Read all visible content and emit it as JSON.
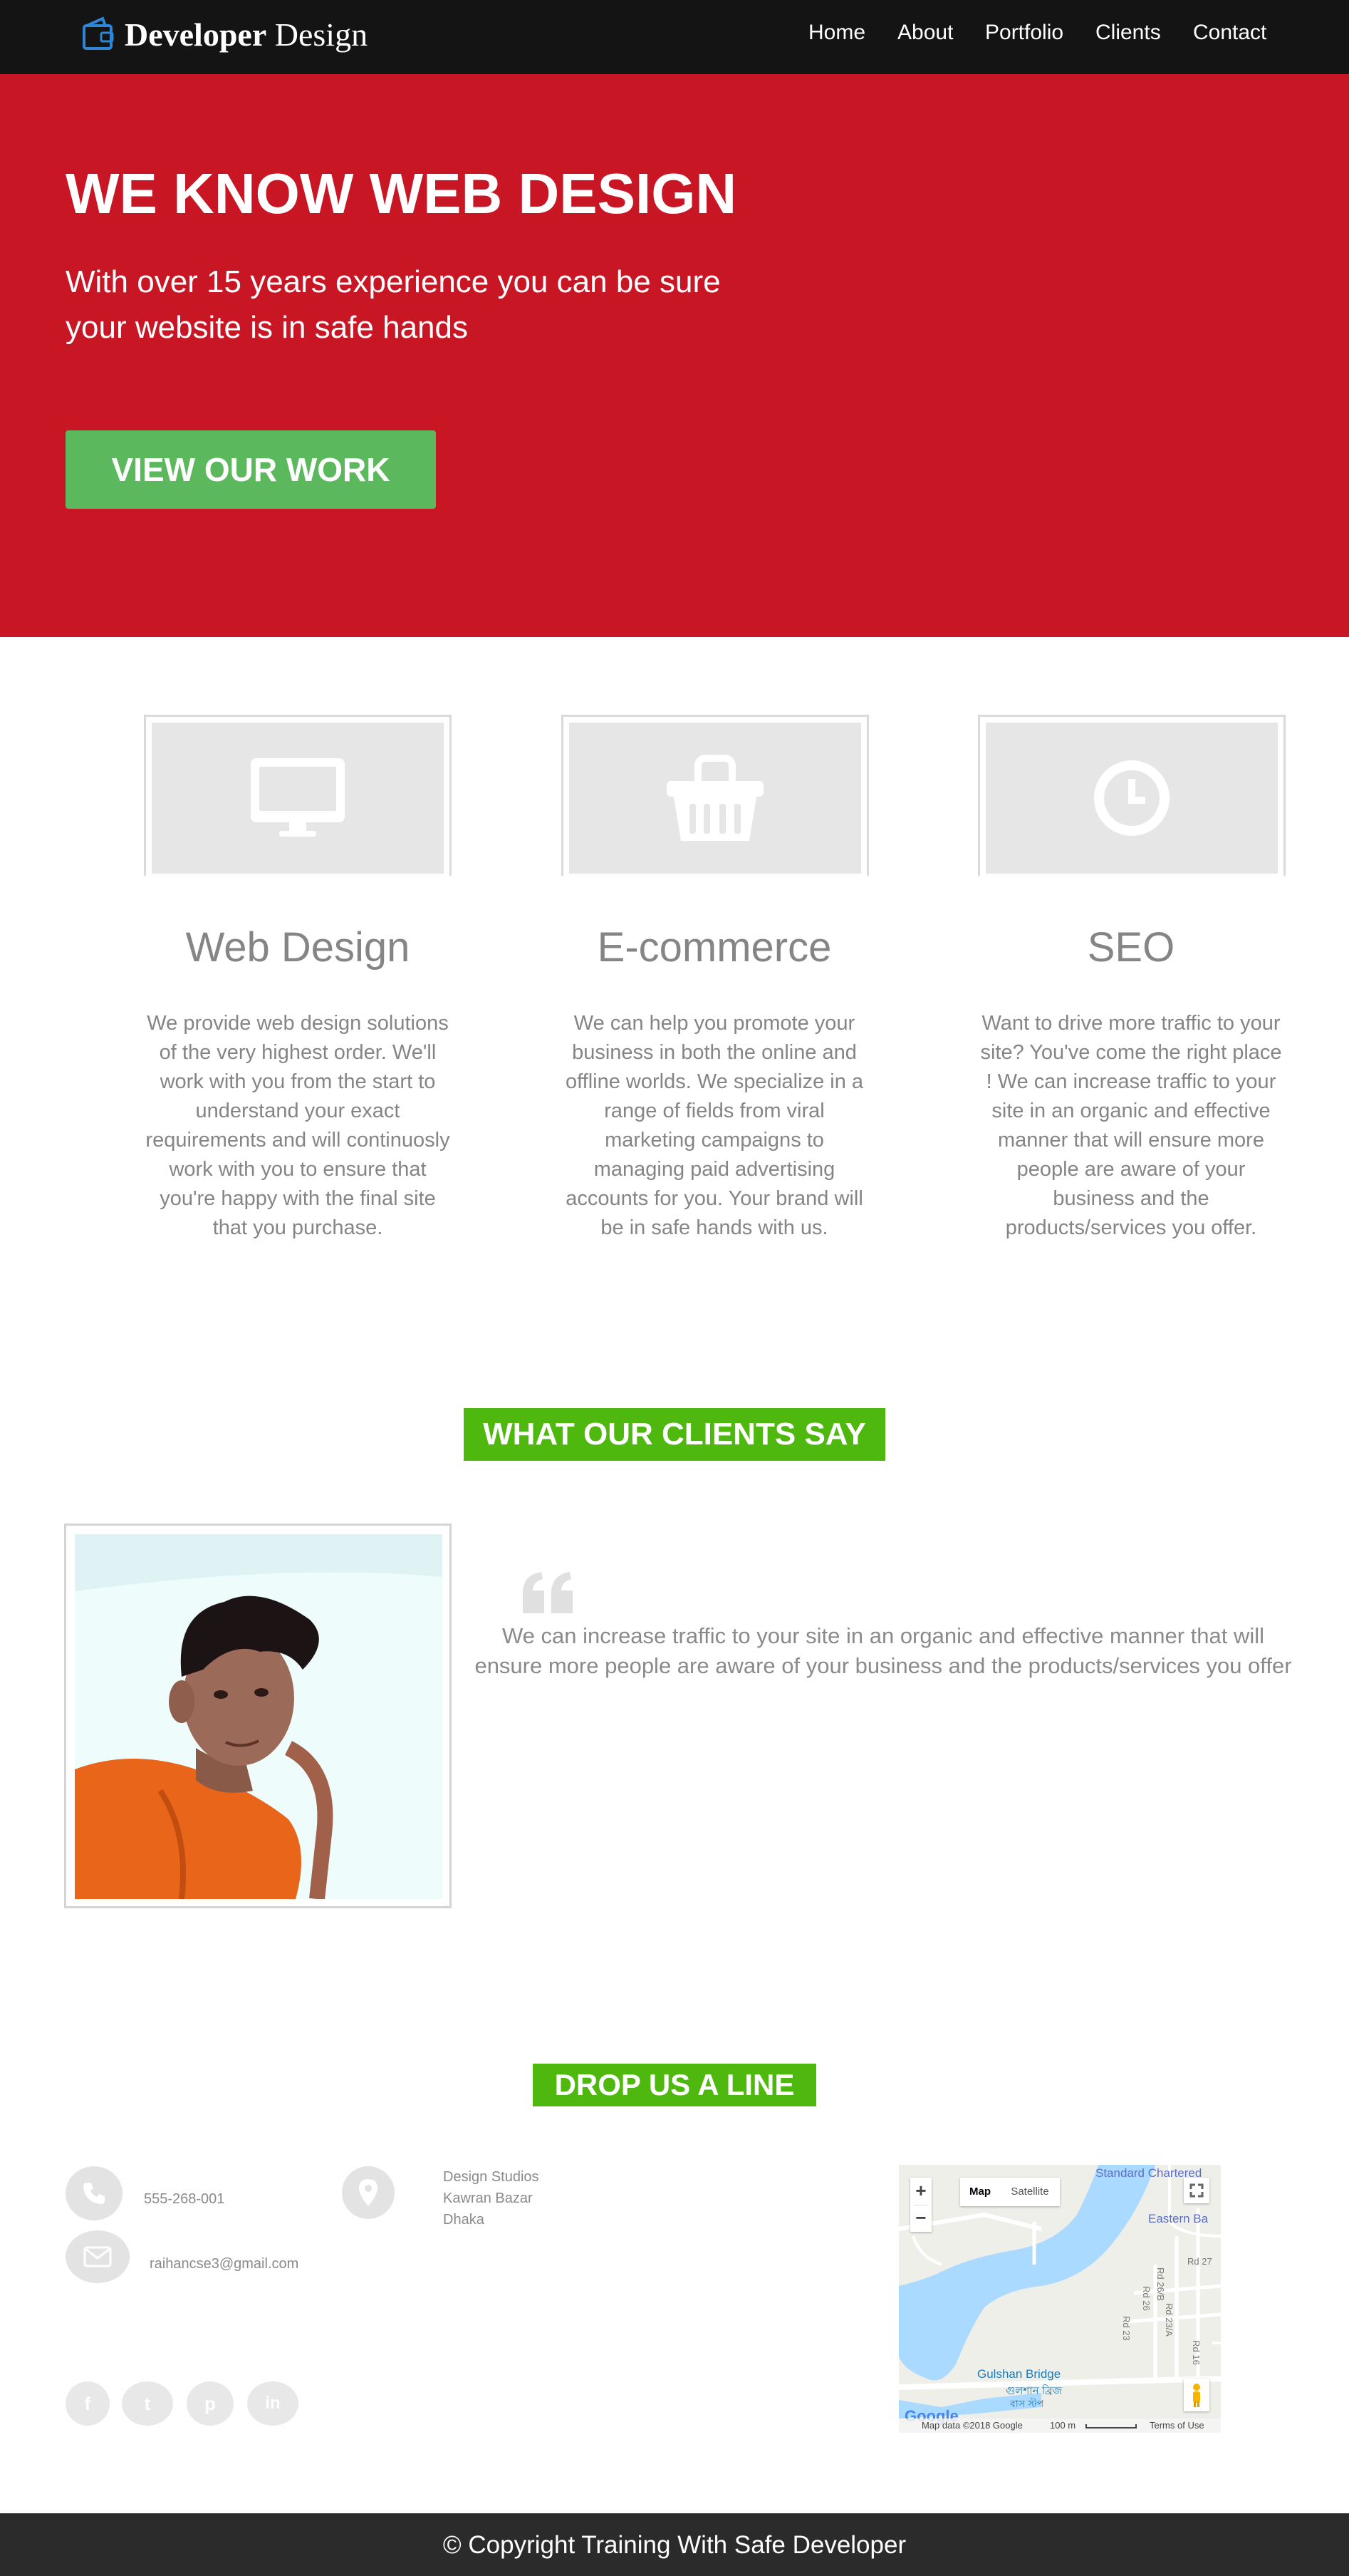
{
  "brand": {
    "bold": "Developer",
    "regular": "Design",
    "icon": "wallet-icon"
  },
  "nav": {
    "items": [
      {
        "label": "Home"
      },
      {
        "label": "About"
      },
      {
        "label": "Portfolio"
      },
      {
        "label": "Clients"
      },
      {
        "label": "Contact"
      }
    ]
  },
  "hero": {
    "title": "WE KNOW WEB DESIGN",
    "subtitle_lines": [
      "With over 15 years experience you can be sure",
      "your website is in safe hands"
    ],
    "button_label": "VIEW OUR WORK",
    "background": "#c81624",
    "button_color": "#5cb85c"
  },
  "services": [
    {
      "icon": "monitor-icon",
      "title": "Web Design",
      "lines": [
        "We provide web design solutions",
        "of the very highest order. We'll",
        "work with you from the start to",
        "understand your exact",
        "requirements and will continuosly",
        "work with you to ensure that",
        "you're happy with the final site",
        "that you purchase."
      ]
    },
    {
      "icon": "shopping-basket-icon",
      "title": "E-commerce",
      "lines": [
        "We can help you promote your",
        "business in both the online and",
        "offline worlds. We specialize in a",
        "range of fields from viral",
        "marketing campaigns to",
        "managing paid advertising",
        "accounts for you. Your brand will",
        "be in safe hands with us."
      ]
    },
    {
      "icon": "clock-icon",
      "title": "SEO",
      "lines": [
        "Want to drive more traffic to your",
        "site? You've come the right place",
        "! We can increase traffic to your",
        "site in an organic and effective",
        "manner that will ensure more",
        "people are aware of your",
        "business and the",
        "products/services you offer."
      ]
    }
  ],
  "testimonials": {
    "heading": "WHAT OUR CLIENTS SAY",
    "quote_icon": "quote-left-icon",
    "quote_lines": [
      "We can increase traffic to your site in an organic and effective manner that will",
      "ensure more people are aware of your business and the products/services you offer"
    ]
  },
  "contact": {
    "heading": "DROP US A LINE",
    "phone": "555-268-001",
    "email": "raihancse3@gmail.com",
    "address_lines": [
      "Design Studios",
      "Kawran Bazar",
      "Dhaka"
    ],
    "icons": [
      "phone-icon",
      "map-marker-icon",
      "envelope-icon"
    ],
    "social": [
      {
        "icon": "facebook-icon",
        "glyph": "f"
      },
      {
        "icon": "twitter-icon",
        "glyph": "t"
      },
      {
        "icon": "pinterest-icon",
        "glyph": "p"
      },
      {
        "icon": "linkedin-icon",
        "glyph": "in"
      }
    ]
  },
  "map": {
    "type_map": "Map",
    "type_satellite": "Satellite",
    "zoom_in": "+",
    "zoom_out": "−",
    "labels": {
      "standard_chartered": "Standard Chartered",
      "eastern_bank": "Eastern Ba",
      "gulshan_bridge": "Gulshan Bridge",
      "gulshan_bridge_bn": "গুলশান ব্রিজ",
      "bus_stop_bn": "বাস স্টপ",
      "rd27": "Rd 27",
      "rd26": "Rd 26",
      "rd23": "Rd 23",
      "rd23a": "Rd 23/A",
      "rd26b": "Rd 26/B",
      "rd16": "Rd 16"
    },
    "google": "Google",
    "attribution": "Map data ©2018 Google",
    "scale": "100 m",
    "terms": "Terms of Use"
  },
  "footer": {
    "copyright": "© Copyright Training With Safe Developer"
  }
}
